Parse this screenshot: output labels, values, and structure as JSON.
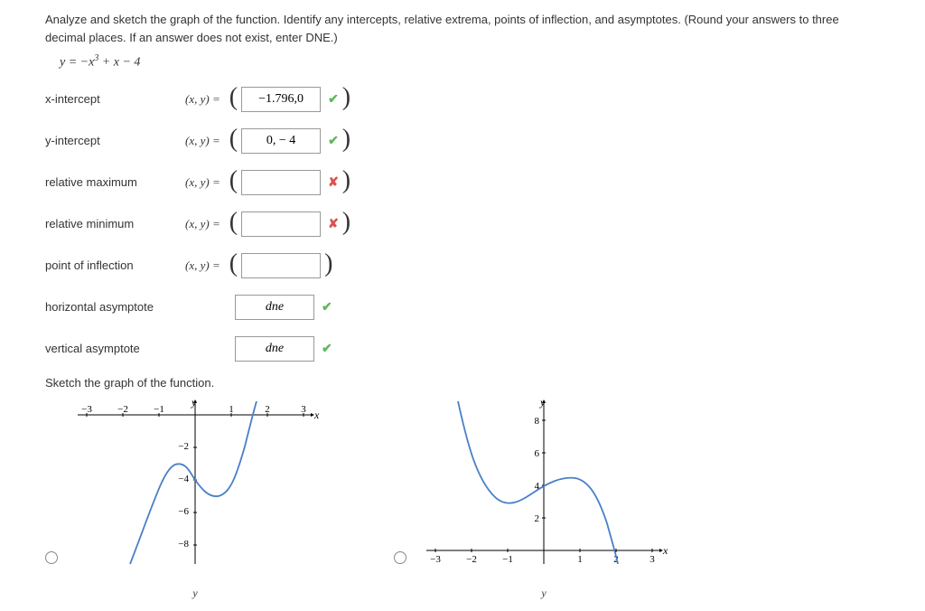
{
  "question": {
    "text": "Analyze and sketch the graph of the function. Identify any intercepts, relative extrema, points of inflection, and asymptotes. (Round your answers to three decimal places. If an answer does not exist, enter DNE.)",
    "equation_prefix": "y = −x",
    "equation_suffix": " + x − 4"
  },
  "rows": {
    "xint": {
      "label": "x-intercept",
      "prefix": "(x, y)  =",
      "value": "−1.796,0",
      "status": "check",
      "parens": true
    },
    "yint": {
      "label": "y-intercept",
      "prefix": "(x, y)  =",
      "value": "0, − 4",
      "status": "check",
      "parens": true
    },
    "rmax": {
      "label": "relative maximum",
      "prefix": "(x, y)  =",
      "value": "",
      "status": "cross",
      "parens": true
    },
    "rmin": {
      "label": "relative minimum",
      "prefix": "(x, y)  =",
      "value": "",
      "status": "cross",
      "parens": true
    },
    "pinf": {
      "label": "point of inflection",
      "prefix": "(x, y)  =",
      "value": "",
      "status": "",
      "parens": true
    },
    "hasy": {
      "label": "horizontal asymptote",
      "prefix": "",
      "value": "dne",
      "status": "check",
      "parens": false
    },
    "vasy": {
      "label": "vertical asymptote",
      "prefix": "",
      "value": "dne",
      "status": "check",
      "parens": false
    }
  },
  "sketch_label": "Sketch the graph of the function.",
  "chart_data": [
    {
      "type": "line",
      "title": "",
      "xlabel": "x",
      "ylabel": "y",
      "xlim": [
        -3.5,
        3.5
      ],
      "ylim": [
        -9,
        1
      ],
      "xticks": [
        -3,
        -2,
        -1,
        1,
        2,
        3
      ],
      "yticks": [
        -2,
        -4,
        -6,
        -8
      ],
      "series": [
        {
          "name": "curve",
          "description": "y = -x^3 + x - 4 (shifted view)",
          "x_range": [
            -2,
            2
          ]
        }
      ]
    },
    {
      "type": "line",
      "title": "",
      "xlabel": "x",
      "ylabel": "y",
      "xlim": [
        -3.5,
        3.5
      ],
      "ylim": [
        -1,
        9
      ],
      "xticks": [
        -3,
        -2,
        -1,
        1,
        2,
        3
      ],
      "yticks": [
        2,
        4,
        6,
        8
      ],
      "series": [
        {
          "name": "curve",
          "description": "cubic with local max then decreasing",
          "x_range": [
            -2.5,
            3
          ]
        }
      ]
    }
  ],
  "axis": {
    "x": "x",
    "y": "y"
  },
  "bottom_labels": {
    "g1": "y",
    "g2": "y"
  },
  "icons": {
    "check": "✔",
    "cross": "✘"
  }
}
